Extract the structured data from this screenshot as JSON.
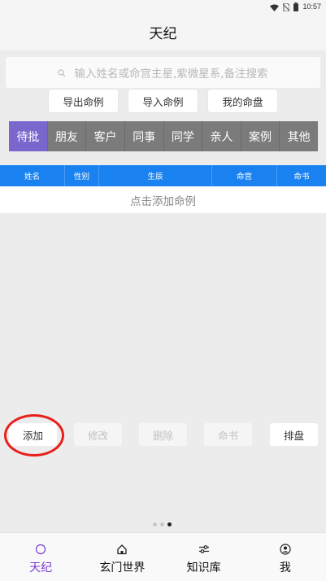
{
  "status_bar": {
    "time": "10:57",
    "icons": [
      "wifi-icon",
      "no-sim-icon",
      "battery-icon"
    ]
  },
  "header": {
    "title": "天纪"
  },
  "search": {
    "placeholder": "输入姓名或命宫主星,紫微星系,备注搜索",
    "icon": "search-icon"
  },
  "actions": {
    "export_label": "导出命例",
    "import_label": "导入命例",
    "my_chart_label": "我的命盘"
  },
  "categories": [
    {
      "label": "待批",
      "active": true
    },
    {
      "label": "朋友",
      "active": false
    },
    {
      "label": "客户",
      "active": false
    },
    {
      "label": "同事",
      "active": false
    },
    {
      "label": "同学",
      "active": false
    },
    {
      "label": "亲人",
      "active": false
    },
    {
      "label": "案例",
      "active": false
    },
    {
      "label": "其他",
      "active": false
    }
  ],
  "table": {
    "columns": [
      "姓名",
      "性别",
      "生辰",
      "命宫",
      "命书"
    ],
    "empty_text": "点击添加命例"
  },
  "bottom_actions": {
    "add_label": "添加",
    "edit_label": "修改",
    "delete_label": "删除",
    "book_label": "命书",
    "arrange_label": "排盘"
  },
  "pager": {
    "count": 3,
    "active_index": 2
  },
  "nav": [
    {
      "label": "天纪",
      "icon": "circle-icon",
      "active": true
    },
    {
      "label": "玄门世界",
      "icon": "home-icon",
      "active": false
    },
    {
      "label": "知识库",
      "icon": "sliders-icon",
      "active": false
    },
    {
      "label": "我",
      "icon": "user-icon",
      "active": false
    }
  ],
  "colors": {
    "accent": "#7a66cc",
    "table_header": "#1a82f0",
    "tab_bg": "#7b7b7b",
    "nav_active": "#7a3ad0",
    "highlight": "#e8201a"
  }
}
